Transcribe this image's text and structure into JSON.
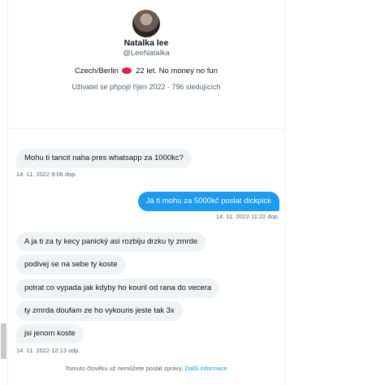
{
  "profile": {
    "name": "Natalka lee",
    "handle": "@LeeNatalka",
    "bio_before": "Czech/Berlin",
    "bio_after": "22 let. No money no fun",
    "meta": "Uživatel se připojil říjen 2022 · 796 sledujících"
  },
  "messages": [
    {
      "type": "received",
      "text": "Mohu ti tancit naha pres whatsapp za 1000kc?",
      "timestamp": "14. 11. 2022 9:06 dop."
    },
    {
      "type": "sent",
      "text": "Já ti mohu za 5000kč poslat dickpick",
      "timestamp": "14. 11. 2022 11:22 dop."
    },
    {
      "type": "received",
      "text": "A ja ti za ty kecy panický asi rozbiju drzku ty zmrde"
    },
    {
      "type": "received",
      "text": "podivej se na sebe ty koste"
    },
    {
      "type": "received",
      "text": "potrat co vypada jak kdyby ho kouril od rana do vecera"
    },
    {
      "type": "received",
      "text": "ty zmrda doufam ze ho vykouris jeste tak 3x"
    },
    {
      "type": "received",
      "text": "jsi jenom koste",
      "timestamp": "14. 11. 2022 12:13 odp."
    }
  ],
  "footer": {
    "notice": "Tomuto člověku už nemůžete poslat zprávy.",
    "link": "Další informace"
  },
  "colors": {
    "accent": "#1d9bf0",
    "received_bubble": "#eff3f4",
    "muted_text": "#536471"
  }
}
